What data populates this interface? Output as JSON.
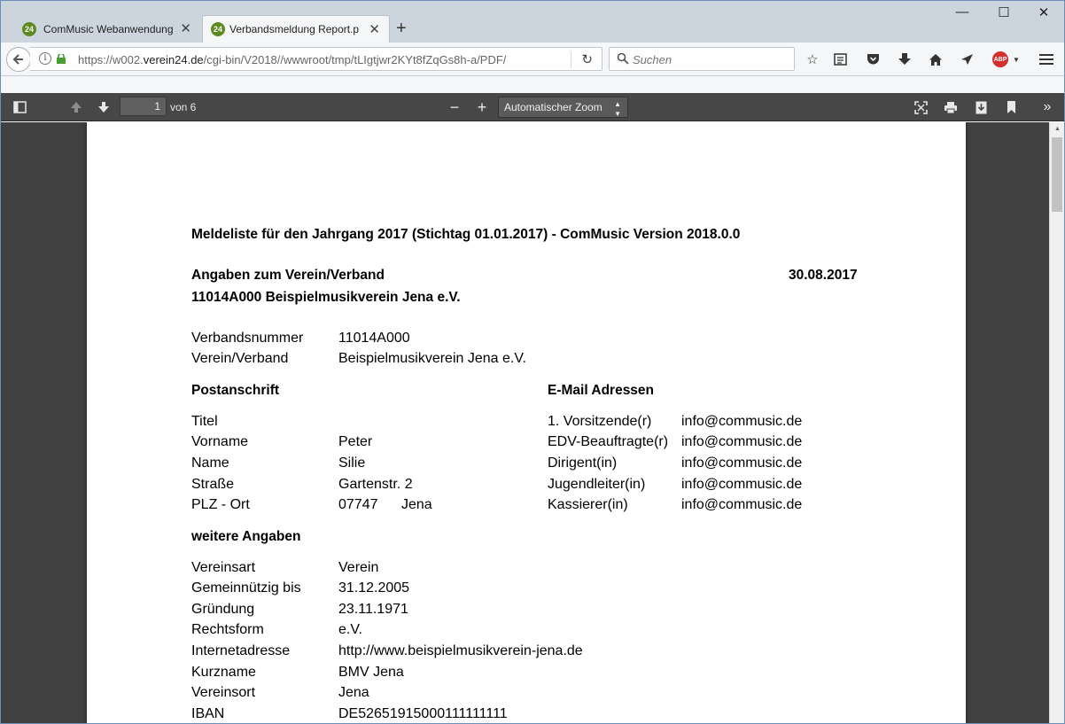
{
  "tabs": [
    {
      "title": "ComMusic Webanwendung",
      "favicon": "24"
    },
    {
      "title": "Verbandsmeldung Report.pdf",
      "favicon": "24"
    }
  ],
  "url": {
    "prefix": "https://w002.",
    "domain": "verein24.de",
    "path": "/cgi-bin/V2018//wwwroot/tmp/tLIgtjwr2KYt8fZqGs8h-a/PDF/"
  },
  "search": {
    "placeholder": "Suchen"
  },
  "pdf_toolbar": {
    "page": "1",
    "of_label": "von 6",
    "zoom": "Automatischer Zoom"
  },
  "colors": {
    "accent_green": "#5c8a1e",
    "pdf_toolbar": "#474747",
    "viewport": "#404040",
    "abp": "#d32f2f"
  },
  "document": {
    "title": "Meldeliste für den Jahrgang 2017 (Stichtag 01.01.2017) - ComMusic Version 2018.0.0",
    "section_heading": "Angaben zum Verein/Verband",
    "date": "30.08.2017",
    "club_heading": "11014A000 Beispielmusikverein Jena e.V.",
    "basic": [
      {
        "label": "Verbandsnummer",
        "value": "11014A000"
      },
      {
        "label": "Verein/Verband",
        "value": "Beispielmusikverein Jena e.V."
      }
    ],
    "postal_heading": "Postanschrift",
    "email_heading": "E-Mail Adressen",
    "postal": [
      {
        "label": "Titel",
        "value": ""
      },
      {
        "label": "Vorname",
        "value": "Peter"
      },
      {
        "label": "Name",
        "value": "Silie"
      },
      {
        "label": "Straße",
        "value": "Gartenstr. 2"
      },
      {
        "label": "PLZ - Ort",
        "value": "07747",
        "value2": "Jena"
      }
    ],
    "emails": [
      {
        "role": "1. Vorsitzende(r)",
        "email": "info@commusic.de"
      },
      {
        "role": "EDV-Beauftragte(r)",
        "email": "info@commusic.de"
      },
      {
        "role": "Dirigent(in)",
        "email": "info@commusic.de"
      },
      {
        "role": "Jugendleiter(in)",
        "email": "info@commusic.de"
      },
      {
        "role": "Kassierer(in)",
        "email": "info@commusic.de"
      }
    ],
    "more_heading": "weitere Angaben",
    "more": [
      {
        "label": "Vereinsart",
        "value": "Verein"
      },
      {
        "label": "Gemeinnützig bis",
        "value": "31.12.2005"
      },
      {
        "label": "Gründung",
        "value": "23.11.1971"
      },
      {
        "label": "Rechtsform",
        "value": "e.V."
      },
      {
        "label": "Internetadresse",
        "value": "http://www.beispielmusikverein-jena.de"
      },
      {
        "label": "Kurzname",
        "value": "BMV Jena"
      },
      {
        "label": "Vereinsort",
        "value": "Jena"
      },
      {
        "label": "IBAN",
        "value": "DE52651915000111111111"
      }
    ]
  }
}
